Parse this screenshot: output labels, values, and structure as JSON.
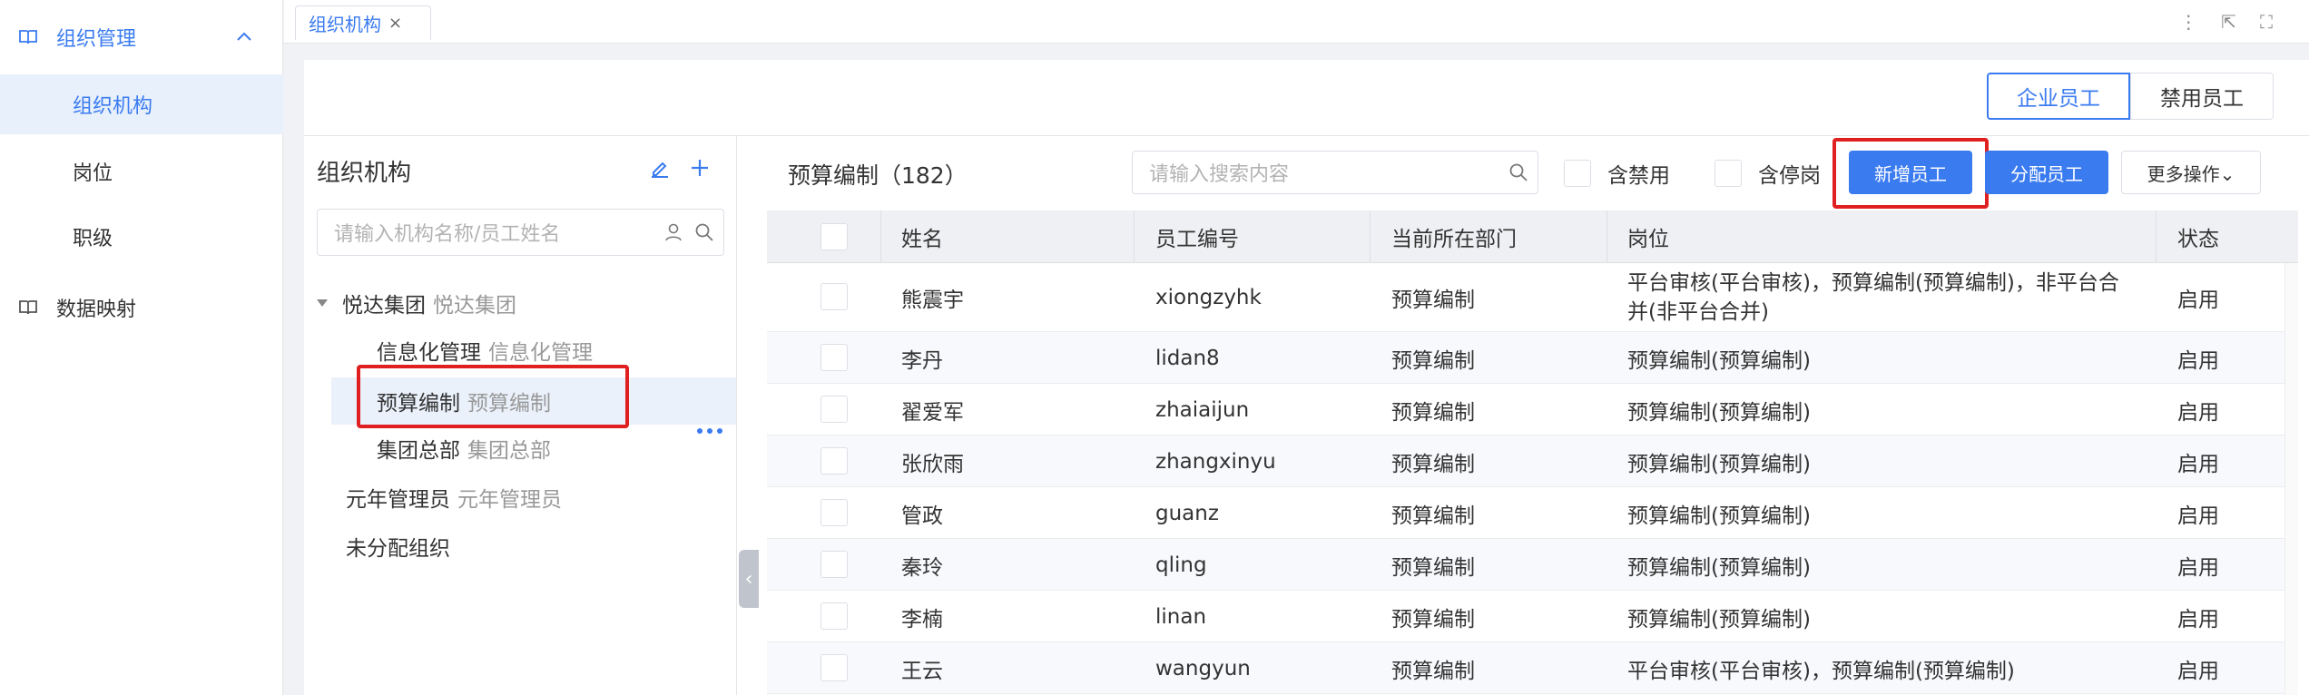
{
  "sidebar": {
    "group1": "组织管理",
    "items": [
      "组织机构",
      "岗位",
      "职级"
    ],
    "group2": "数据映射"
  },
  "tabbar": {
    "tab": "组织机构",
    "close": "×",
    "tools": [
      "⋮",
      "⇱",
      "⛶"
    ]
  },
  "toggle": {
    "active": "企业员工",
    "inactive": "禁用员工"
  },
  "tree": {
    "title": "组织机构",
    "search_placeholder": "请输入机构名称/员工姓名",
    "nodes": [
      {
        "name": "悦达集团",
        "sub": "悦达集团"
      },
      {
        "name": "信息化管理",
        "sub": "信息化管理"
      },
      {
        "name": "预算编制",
        "sub": "预算编制"
      },
      {
        "name": "集团总部",
        "sub": "集团总部"
      },
      {
        "name": "元年管理员",
        "sub": "元年管理员"
      },
      {
        "name": "未分配组织",
        "sub": ""
      }
    ],
    "collapse_glyph": "‹"
  },
  "toolbar": {
    "dept_title": "预算编制（182）",
    "search_placeholder": "请输入搜索内容",
    "include_disabled": "含禁用",
    "include_suspended": "含停岗",
    "add_label": "新增员工",
    "assign_label": "分配员工",
    "more_label": "更多操作⌄"
  },
  "table": {
    "headers": [
      "姓名",
      "员工编号",
      "当前所在部门",
      "岗位",
      "状态"
    ],
    "rows": [
      {
        "name": "熊震宇",
        "code": "xiongzyhk",
        "dept": "预算编制",
        "pos": "平台审核(平台审核)，预算编制(预算编制)，非平台合并(非平台合并)",
        "status": "启用"
      },
      {
        "name": "李丹",
        "code": "lidan8",
        "dept": "预算编制",
        "pos": "预算编制(预算编制)",
        "status": "启用"
      },
      {
        "name": "翟爱军",
        "code": "zhaiaijun",
        "dept": "预算编制",
        "pos": "预算编制(预算编制)",
        "status": "启用"
      },
      {
        "name": "张欣雨",
        "code": "zhangxinyu",
        "dept": "预算编制",
        "pos": "预算编制(预算编制)",
        "status": "启用"
      },
      {
        "name": "管政",
        "code": "guanz",
        "dept": "预算编制",
        "pos": "预算编制(预算编制)",
        "status": "启用"
      },
      {
        "name": "秦玲",
        "code": "qling",
        "dept": "预算编制",
        "pos": "预算编制(预算编制)",
        "status": "启用"
      },
      {
        "name": "李楠",
        "code": "linan",
        "dept": "预算编制",
        "pos": "预算编制(预算编制)",
        "status": "启用"
      },
      {
        "name": "王云",
        "code": "wangyun",
        "dept": "预算编制",
        "pos": "平台审核(平台审核)，预算编制(预算编制)",
        "status": "启用"
      }
    ]
  },
  "colors": {
    "accent": "#3a7bf0",
    "highlight": "#e02020"
  }
}
